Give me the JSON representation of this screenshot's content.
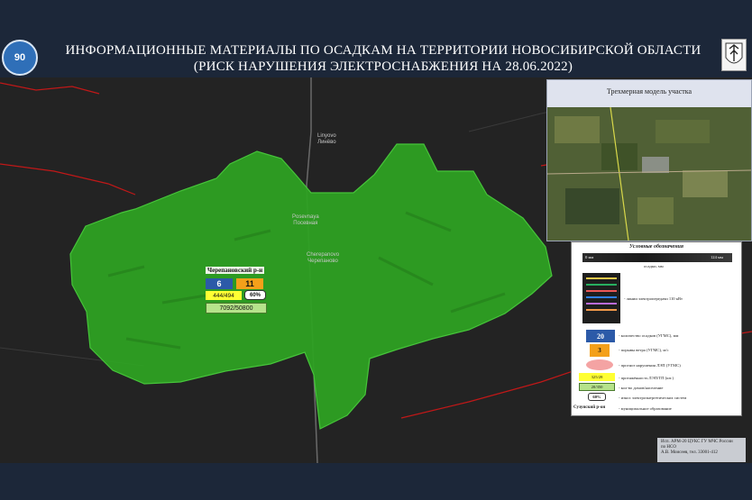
{
  "header": {
    "title_line1": "ИНФОРМАЦИОННЫЕ МАТЕРИАЛЫ ПО ОСАДКАМ НА ТЕРРИТОРИИ НОВОСИБИРСКОЙ ОБЛАСТИ",
    "title_line2": "(РИСК НАРУШЕНИЯ ЭЛЕКТРОСНАБЖЕНИЯ НА 28.06.2022)",
    "emblem_left_text": "90"
  },
  "map": {
    "places": [
      {
        "name": "Linyovo",
        "name_ru": "Линёво"
      },
      {
        "name": "Posevnaya",
        "name_ru": "Посевная"
      },
      {
        "name": "Cherepanovo",
        "name_ru": "Черепаново"
      }
    ],
    "district": {
      "name": "Черепановский р-н",
      "precipitation": "6",
      "wind": "11",
      "capacity": "444/494",
      "percent": "60%",
      "households": "7092/50800"
    },
    "colors": {
      "district_fill": "#2ea123",
      "precipitation": "#2c5aa8",
      "wind": "#f4a01a",
      "capacity": "#ffff33",
      "households": "#b6e38b"
    }
  },
  "panel_3d": {
    "title": "Трехмерная модель участка"
  },
  "legend": {
    "title": "Условные обозначения",
    "scale_min": "0 мм",
    "scale_max": "124 мм",
    "scale_caption": "осадки, мм",
    "lep_label": "- линии электропередачи 110 кВт",
    "precip_sample": "20",
    "precip_label": "- количество осадков (УГМС), мм",
    "wind_sample": "3",
    "wind_label": "- порывы ветра (УГМС), м/с",
    "forecast_label": "- прогноз нарушения ЛЭП (УГМС)",
    "capacity_sample": "325/28",
    "capacity_label": "- протяжённость ЛЭП/ТП (шт.)",
    "households_sample": "20/350",
    "households_label": "- кол-во домов/население",
    "percent_sample": "60%",
    "percent_label": "- износ электроэнергетических систем",
    "district_sample": "Сузунский р-он",
    "district_label": "- муниципальное образование"
  },
  "credit": {
    "line1": "Исп. АРМ-20 ЦУКС ГУ МЧС России",
    "line2": "по НСО",
    "line3": "А.В. Моисеев, тел. 33001-412"
  }
}
